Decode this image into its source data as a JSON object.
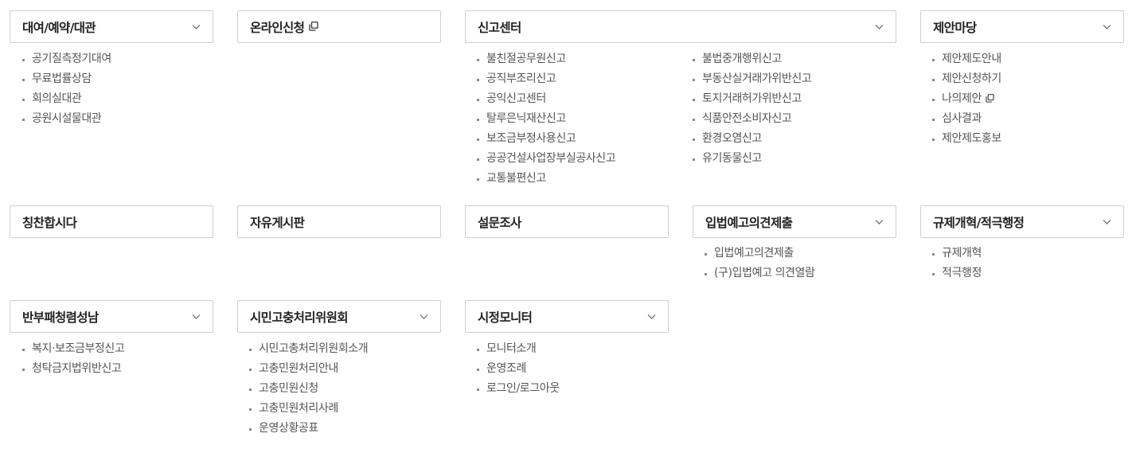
{
  "menus": {
    "rental": {
      "title": "대여/예약/대관",
      "items": [
        "공기질측정기대여",
        "무료법률상담",
        "회의실대관",
        "공원시설물대관"
      ]
    },
    "online": {
      "title": "온라인신청"
    },
    "report": {
      "title": "신고센터",
      "col1": [
        "불친절공무원신고",
        "공직부조리신고",
        "공익신고센터",
        "탈루은닉재산신고",
        "보조금부정사용신고",
        "공공건설사업장부실공사신고",
        "교통불편신고"
      ],
      "col2": [
        "불법중개행위신고",
        "부동산실거래가위반신고",
        "토지거래허가위반신고",
        "식품안전소비자신고",
        "환경오염신고",
        "유기동물신고"
      ]
    },
    "proposal": {
      "title": "제안마당",
      "items": [
        "제안제도안내",
        "제안신청하기",
        "나의제안",
        "심사결과",
        "제안제도홍보"
      ]
    },
    "praise": {
      "title": "칭찬합시다"
    },
    "board": {
      "title": "자유게시판"
    },
    "survey": {
      "title": "설문조사"
    },
    "legislation": {
      "title": "입법예고의견제출",
      "items": [
        "입법예고의견제출",
        "(구)입법예고 의견열람"
      ]
    },
    "regulation": {
      "title": "규제개혁/적극행정",
      "items": [
        "규제개혁",
        "적극행정"
      ]
    },
    "anticorruption": {
      "title": "반부패청렴성남",
      "items": [
        "복지·보조금부정신고",
        "청탁금지법위반신고"
      ]
    },
    "grievance": {
      "title": "시민고충처리위원회",
      "items": [
        "시민고충처리위원회소개",
        "고충민원처리안내",
        "고충민원신청",
        "고충민원처리사례",
        "운영상황공표"
      ]
    },
    "monitor": {
      "title": "시정모니터",
      "items": [
        "모니터소개",
        "운영조례",
        "로그인/로그아웃"
      ]
    }
  },
  "icons": {
    "dropdown": "chevron-down-icon",
    "new_window": "new-window-icon"
  },
  "colors": {
    "border": "#cfcfcf",
    "title": "#222222",
    "link": "#555555",
    "bullet": "#8a8a8a"
  }
}
